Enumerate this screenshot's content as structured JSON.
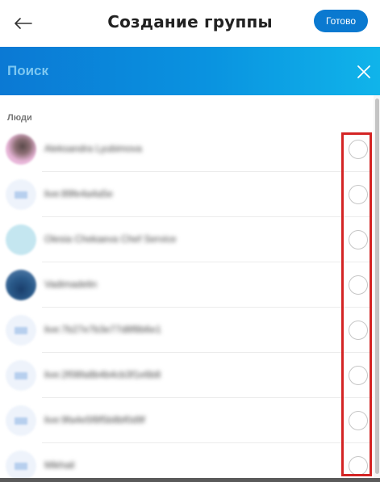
{
  "header": {
    "back_icon": "arrow-left-icon",
    "title": "Создание группы",
    "done_label": "Готово"
  },
  "search": {
    "placeholder": "Поиск",
    "value": "",
    "close_icon": "close-icon"
  },
  "colors": {
    "accent": "#0a79d0",
    "search_bar_start": "#0b79d4",
    "search_bar_end": "#10b4ea",
    "highlight": "#d42424"
  },
  "people": {
    "section_label": "Люди",
    "contacts": [
      {
        "name": "Aleksandra Lyubimova",
        "avatar": "photo",
        "selected": false
      },
      {
        "name": "live:89fe4a4a5e",
        "avatar": "default",
        "selected": false
      },
      {
        "name": "Olesia Chekaeva Chef Service",
        "avatar": "photo",
        "selected": false
      },
      {
        "name": "Vadimadelin",
        "avatar": "photo",
        "selected": false
      },
      {
        "name": "live:7b27e7b3e77d8f8b6e1",
        "avatar": "default",
        "selected": false
      },
      {
        "name": "live:2f08fa8b4b4cb3f1e6b8",
        "avatar": "default",
        "selected": false
      },
      {
        "name": "live:9fa4e5f8f5b8bf0d9f",
        "avatar": "default",
        "selected": false
      },
      {
        "name": "Mikhail",
        "avatar": "default",
        "selected": false
      }
    ]
  }
}
